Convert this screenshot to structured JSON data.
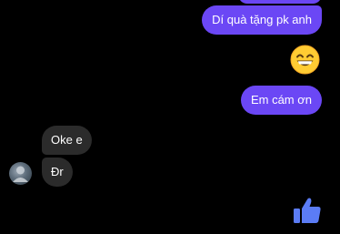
{
  "conversation": {
    "messages_out": [
      {
        "text": "Dí quà tặng pk anh"
      },
      {
        "text": "Em cám ơn"
      }
    ],
    "messages_in": [
      {
        "text": "Oke e"
      },
      {
        "text": "Đr"
      }
    ],
    "emoji": "grinning-face-with-smiling-eyes",
    "like_icon": "thumbs-up-icon"
  },
  "colors": {
    "outgoing_bubble": "#6b47f5",
    "incoming_bubble": "#2b2b2b",
    "background": "#000000",
    "like": "#5b7cf5"
  }
}
